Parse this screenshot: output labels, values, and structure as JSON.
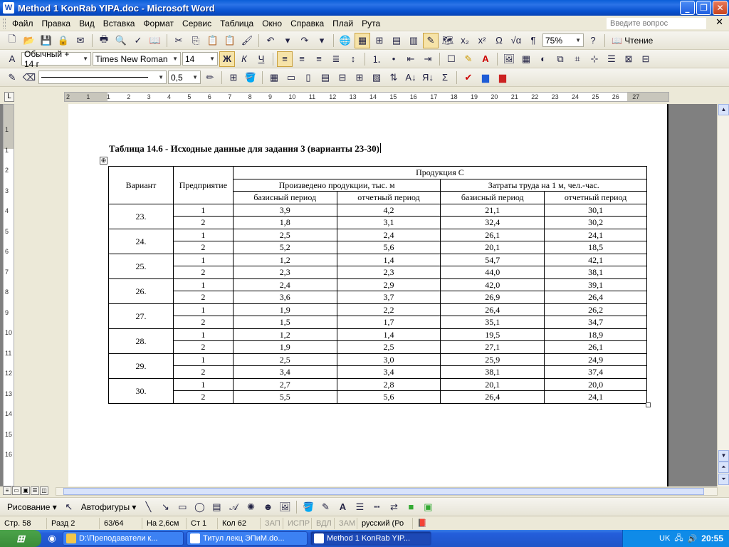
{
  "window": {
    "title": "Method 1 KonRab YIPA.doc - Microsoft Word"
  },
  "menu": {
    "items": [
      "Файл",
      "Правка",
      "Вид",
      "Вставка",
      "Формат",
      "Сервис",
      "Таблица",
      "Окно",
      "Справка",
      "Плай",
      "Рута"
    ],
    "help_placeholder": "Введите вопрос"
  },
  "toolbar": {
    "zoom": "75%",
    "reading_label": "Чтение",
    "style": "Обычный + 14 г",
    "font": "Times New Roman",
    "size": "14",
    "bold": "Ж",
    "italic": "К",
    "underline": "Ч",
    "line_weight": "0,5"
  },
  "ruler": {
    "labels": [
      "2",
      "1",
      "1",
      "2",
      "3",
      "4",
      "5",
      "6",
      "7",
      "8",
      "9",
      "10",
      "11",
      "12",
      "13",
      "14",
      "15",
      "16",
      "17",
      "18",
      "19",
      "20",
      "21",
      "22",
      "23",
      "24",
      "25",
      "26",
      "27"
    ]
  },
  "vruler": {
    "labels": [
      "1",
      "1",
      "2",
      "3",
      "4",
      "5",
      "6",
      "7",
      "8",
      "9",
      "10",
      "11",
      "12",
      "13",
      "14",
      "15",
      "16"
    ]
  },
  "document": {
    "caption": "Таблица 14.6 - Исходные данные для задания 3 (варианты 23-30)",
    "move_handle_glyph": "⊕",
    "table": {
      "header": {
        "variant": "Вариант",
        "enterprise": "Предприятие",
        "product": "Продукция С",
        "produced": "Произведено продукции, тыс. м",
        "labor": "Затраты труда на 1 м, чел.-час.",
        "base": "базисный период",
        "report": "отчетный период"
      },
      "variants": [
        {
          "variant": "23.",
          "rows": [
            [
              "1",
              "3,9",
              "4,2",
              "21,1",
              "30,1"
            ],
            [
              "2",
              "1,8",
              "3,1",
              "32,4",
              "30,2"
            ]
          ]
        },
        {
          "variant": "24.",
          "rows": [
            [
              "1",
              "2,5",
              "2,4",
              "26,1",
              "24,1"
            ],
            [
              "2",
              "5,2",
              "5,6",
              "20,1",
              "18,5"
            ]
          ]
        },
        {
          "variant": "25.",
          "rows": [
            [
              "1",
              "1,2",
              "1,4",
              "54,7",
              "42,1"
            ],
            [
              "2",
              "2,3",
              "2,3",
              "44,0",
              "38,1"
            ]
          ]
        },
        {
          "variant": "26.",
          "rows": [
            [
              "1",
              "2,4",
              "2,9",
              "42,0",
              "39,1"
            ],
            [
              "2",
              "3,6",
              "3,7",
              "26,9",
              "26,4"
            ]
          ]
        },
        {
          "variant": "27.",
          "rows": [
            [
              "1",
              "1,9",
              "2,2",
              "26,4",
              "26,2"
            ],
            [
              "2",
              "1,5",
              "1,7",
              "35,1",
              "34,7"
            ]
          ]
        },
        {
          "variant": "28.",
          "rows": [
            [
              "1",
              "1,2",
              "1,4",
              "19,5",
              "18,9"
            ],
            [
              "2",
              "1,9",
              "2,5",
              "27,1",
              "26,1"
            ]
          ]
        },
        {
          "variant": "29.",
          "rows": [
            [
              "1",
              "2,5",
              "3,0",
              "25,9",
              "24,9"
            ],
            [
              "2",
              "3,4",
              "3,4",
              "38,1",
              "37,4"
            ]
          ]
        },
        {
          "variant": "30.",
          "rows": [
            [
              "1",
              "2,7",
              "2,8",
              "20,1",
              "20,0"
            ],
            [
              "2",
              "5,5",
              "5,6",
              "26,4",
              "24,1"
            ]
          ]
        }
      ]
    }
  },
  "drawbar": {
    "drawing": "Рисование",
    "autoshapes": "Автофигуры"
  },
  "status": {
    "page": "Стр. 58",
    "section": "Разд 2",
    "pages": "63/64",
    "at": "На 2,6см",
    "line": "Ст 1",
    "col": "Кол 62",
    "rec": "ЗАП",
    "trk": "ИСПР",
    "ext": "ВДЛ",
    "ovr": "ЗАМ",
    "lang": "русский (Ро"
  },
  "taskbar": {
    "tasks": [
      "D:\\Преподаватели к...",
      "Титул лекц ЭПиМ.do...",
      "Method 1 KonRab YIP..."
    ],
    "lang": "UK",
    "clock": "20:55"
  }
}
